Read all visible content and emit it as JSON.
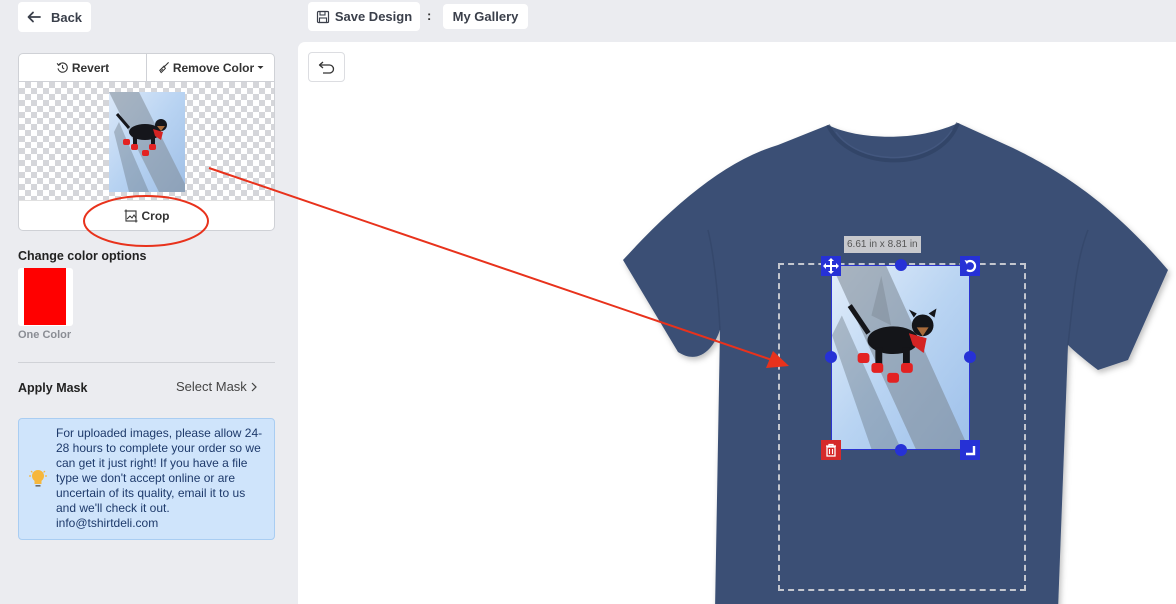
{
  "header": {
    "back_label": "Back",
    "save_label": "Save Design",
    "separator": ":",
    "gallery_label": "My Gallery"
  },
  "image_card": {
    "revert_label": "Revert",
    "remove_color_label": "Remove Color",
    "crop_label": "Crop"
  },
  "color_options": {
    "title": "Change color options",
    "swatch_color": "#ff0000",
    "swatch_label": "One Color"
  },
  "mask": {
    "label": "Apply Mask",
    "select_label": "Select Mask"
  },
  "info": {
    "text": "For uploaded images, please allow 24-28 hours to complete your order so we can get it just right! If you have a file type we don't accept online or are uncertain of its quality, email it to us and we'll check it out. info@tshirtdeli.com"
  },
  "canvas": {
    "size_label": "6.61 in x 8.81 in",
    "shirt_color": "#3b5074",
    "handle_color": "#2631d6",
    "delete_color": "#d62a2a"
  },
  "annotation": {
    "color": "#e8321c"
  }
}
